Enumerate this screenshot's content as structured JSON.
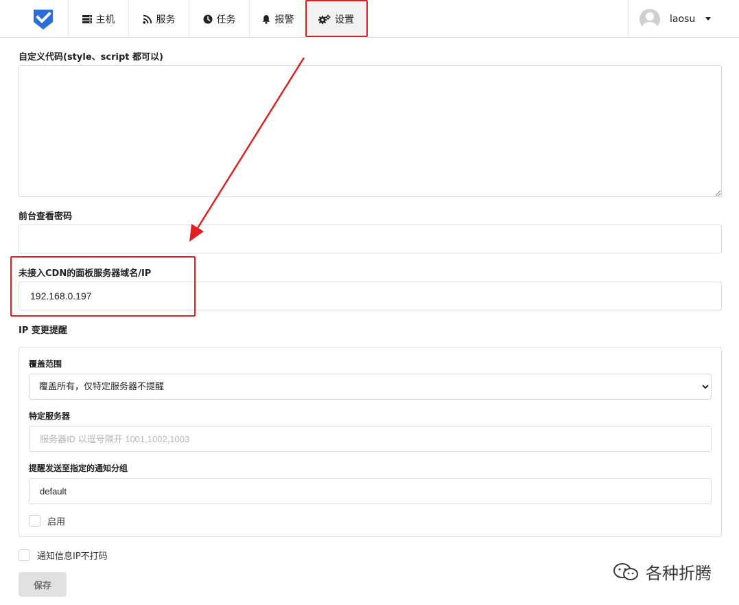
{
  "header": {
    "nav": [
      {
        "label": "主机",
        "icon": "server-icon"
      },
      {
        "label": "服务",
        "icon": "rss-icon"
      },
      {
        "label": "任务",
        "icon": "clock-icon"
      },
      {
        "label": "报警",
        "icon": "bell-icon"
      },
      {
        "label": "设置",
        "icon": "gears-icon"
      }
    ],
    "active_nav": "设置",
    "username": "laosu"
  },
  "form": {
    "custom_code_label": "自定义代码(style、script 都可以)",
    "custom_code_value": "",
    "view_password_label": "前台查看密码",
    "view_password_value": "",
    "dashboard_domain_label": "未接入CDN的面板服务器域名/IP",
    "dashboard_domain_value": "192.168.0.197",
    "ip_change_title": "IP 变更提醒",
    "ip_change": {
      "coverage_label": "覆盖范围",
      "coverage_selected": "覆盖所有，仅特定服务器不提醒",
      "specific_servers_label": "特定服务器",
      "specific_servers_placeholder": "服务器ID 以逗号隔开 1001,1002,1003",
      "notify_group_label": "提醒发送至指定的通知分组",
      "notify_group_value": "default",
      "enable_label": "启用"
    },
    "no_mask_ip_label": "通知信息IP不打码",
    "save_label": "保存"
  },
  "watermark": "各种折腾",
  "colors": {
    "highlight": "#e02020",
    "logo_blue": "#2b6fd6"
  }
}
